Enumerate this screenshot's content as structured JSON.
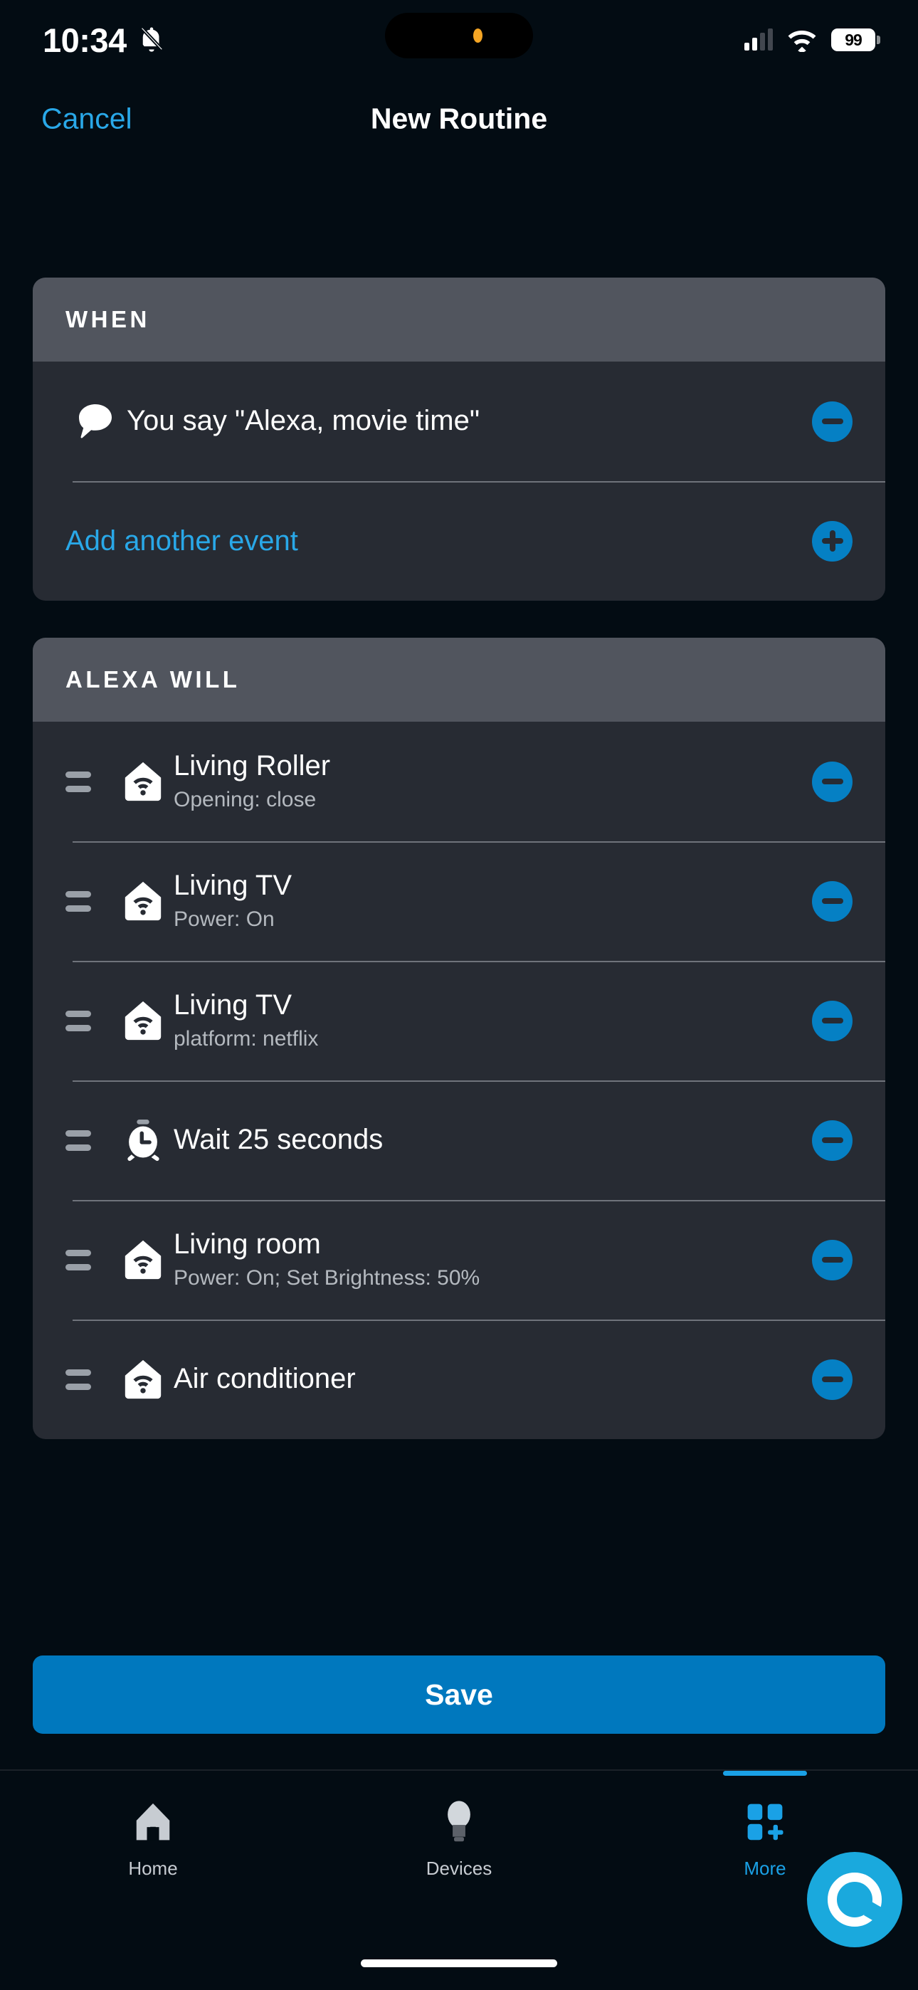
{
  "status_bar": {
    "time": "10:34",
    "mute_icon": "bell-slash-icon",
    "signal_icon": "cellular-signal-icon",
    "wifi_icon": "wifi-icon",
    "battery_level": "99"
  },
  "nav": {
    "cancel_label": "Cancel",
    "title": "New Routine"
  },
  "when_section": {
    "header": "WHEN",
    "items": [
      {
        "icon": "speech-bubble-icon",
        "title": "You say \"Alexa, movie time\"",
        "subtitle": "",
        "action": "remove"
      }
    ],
    "add_label": "Add another event"
  },
  "actions_section": {
    "header": "ALEXA WILL",
    "items": [
      {
        "icon": "smart-home-device-icon",
        "title": "Living Roller",
        "subtitle": "Opening: close"
      },
      {
        "icon": "smart-home-device-icon",
        "title": "Living TV",
        "subtitle": "Power: On"
      },
      {
        "icon": "smart-home-device-icon",
        "title": "Living TV",
        "subtitle": "platform: netflix"
      },
      {
        "icon": "alarm-clock-icon",
        "title": "Wait 25 seconds",
        "subtitle": ""
      },
      {
        "icon": "smart-home-device-icon",
        "title": "Living room",
        "subtitle": "Power: On; Set Brightness: 50%"
      },
      {
        "icon": "smart-home-device-icon",
        "title": "Air conditioner",
        "subtitle": ""
      }
    ]
  },
  "save": {
    "label": "Save"
  },
  "assistant_fab": {
    "icon": "alexa-logo-icon"
  },
  "tabbar": {
    "tabs": [
      {
        "label": "Home",
        "icon": "home-icon",
        "active": false
      },
      {
        "label": "Devices",
        "icon": "lightbulb-icon",
        "active": false
      },
      {
        "label": "More",
        "icon": "more-grid-icon",
        "active": true
      }
    ]
  },
  "colors": {
    "background": "#030c13",
    "card": "#272b33",
    "card_header": "#51555e",
    "accent_blue": "#0580c4",
    "link_blue": "#29a8e8",
    "save_blue": "#0078be",
    "fab_cyan": "#1aa9dd"
  }
}
